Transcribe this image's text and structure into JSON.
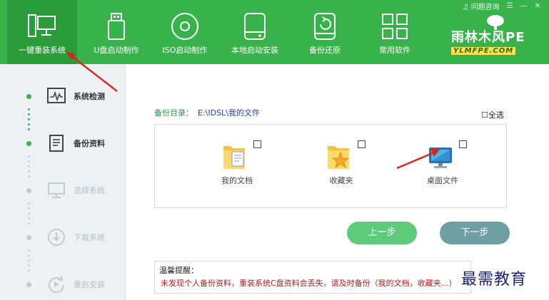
{
  "header": {
    "tabs": [
      {
        "label": "一键重装系统",
        "icon": "computer-monitor-icon"
      },
      {
        "label": "U盘启动制作",
        "icon": "usb-drive-icon"
      },
      {
        "label": "ISO启动制作",
        "icon": "disc-icon"
      },
      {
        "label": "本地启动安装",
        "icon": "hard-drive-icon"
      },
      {
        "label": "备份还原",
        "icon": "backup-restore-icon"
      },
      {
        "label": "常用软件",
        "icon": "app-grid-icon"
      }
    ],
    "help_label": "问题咨询",
    "menu_glyph": "☰",
    "minimize_glyph": "—",
    "close_glyph": "✕",
    "brand_name": "雨林木风PE",
    "brand_url": "YLMFPE.COM"
  },
  "sidebar": {
    "steps": [
      {
        "label": "系统检测",
        "icon": "pulse-monitor-icon",
        "done": true
      },
      {
        "label": "备份资料",
        "icon": "document-icon",
        "done": true
      },
      {
        "label": "选择系统",
        "icon": "monitor-icon",
        "done": false
      },
      {
        "label": "下载系统",
        "icon": "download-icon",
        "done": false
      },
      {
        "label": "重启安装",
        "icon": "restart-icon",
        "done": false
      }
    ]
  },
  "main": {
    "backup_dir_label": "备份目录：",
    "backup_dir_path": "E:\\IDSL\\我的文件",
    "select_all_label": "全选",
    "items": [
      {
        "label": "我的文档",
        "icon": "documents-folder-icon",
        "checked": false
      },
      {
        "label": "收藏夹",
        "icon": "favorites-folder-icon",
        "checked": false
      },
      {
        "label": "桌面文件",
        "icon": "desktop-icon",
        "checked": false
      }
    ],
    "prev_button": "上一步",
    "next_button": "下一步",
    "tips_title": "温馨提醒：",
    "tips_text": "未发现个人备份资料，重装系统C盘资料会丢失，请及时备份（我的文档，收藏夹…）"
  },
  "watermark": "最需教育",
  "colors": {
    "header_green": "#38b24a",
    "active_tab": "#2b9c3a",
    "prev_button": "#5ecb7a",
    "next_button": "#6e9fa3",
    "warning_text": "#b01c1c",
    "annotation_arrow": "#d7261e"
  }
}
